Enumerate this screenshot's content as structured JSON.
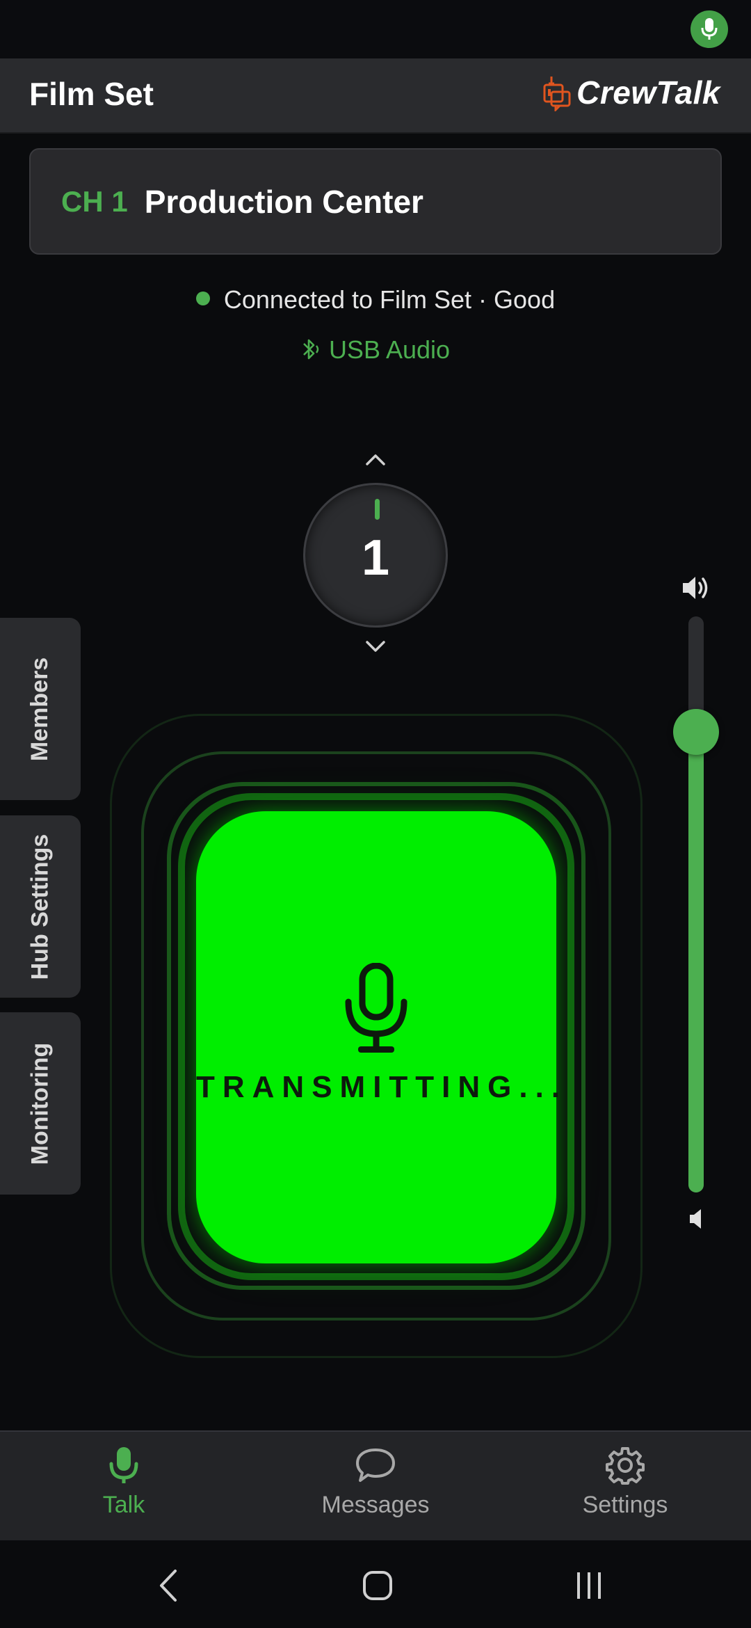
{
  "status_bar": {
    "icon": "mic-icon"
  },
  "header": {
    "title": "Film Set",
    "brand": "CrewTalk",
    "brand_icon": "crewtalk-logo-icon"
  },
  "channel": {
    "code": "CH 1",
    "name": "Production Center"
  },
  "connection": {
    "text": "Connected to Film Set · Good",
    "status_color": "#4caf50"
  },
  "audio": {
    "label": "USB Audio",
    "icon": "bluetooth-audio-icon"
  },
  "dial": {
    "value": "1"
  },
  "side_tabs": [
    {
      "label": "Members"
    },
    {
      "label": "Hub Settings"
    },
    {
      "label": "Monitoring"
    }
  ],
  "talk_button": {
    "label": "TRANSMITTING...",
    "color": "#00ee00",
    "icon": "microphone-icon"
  },
  "volume": {
    "level_percent": 80
  },
  "bottom_nav": [
    {
      "label": "Talk",
      "icon": "mic-icon",
      "active": true
    },
    {
      "label": "Messages",
      "icon": "chat-bubble-icon",
      "active": false
    },
    {
      "label": "Settings",
      "icon": "gear-icon",
      "active": false
    }
  ],
  "colors": {
    "accent": "#4caf50",
    "transmit": "#00ee00",
    "brand_orange": "#e0551f"
  }
}
